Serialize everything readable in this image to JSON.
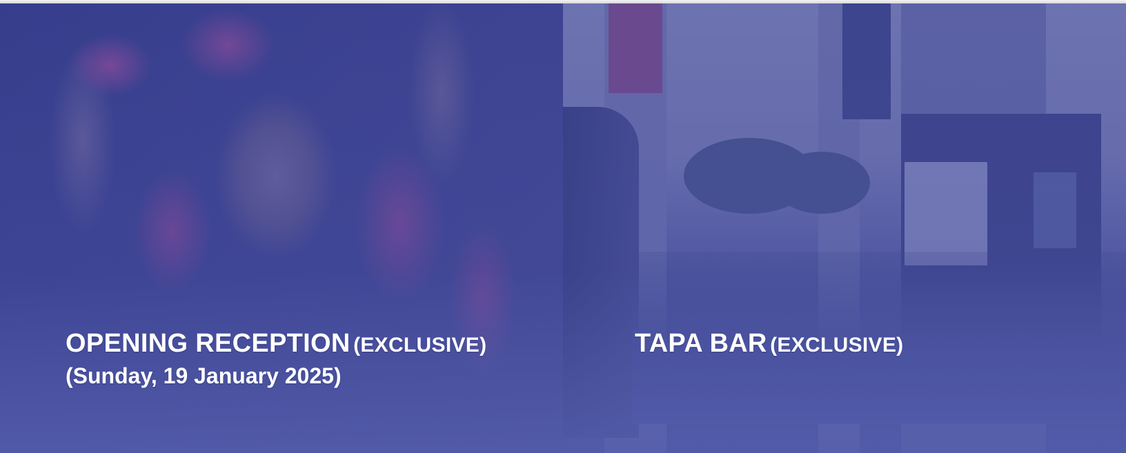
{
  "cards": [
    {
      "title": "OPENING RECEPTION",
      "tag": "(EXCLUSIVE)",
      "date": "(Sunday, 19 January 2025)"
    },
    {
      "title": "TAPA BAR",
      "tag": "(EXCLUSIVE)"
    }
  ],
  "colors": {
    "overlay": "#424a9c",
    "text": "#ffffff"
  }
}
